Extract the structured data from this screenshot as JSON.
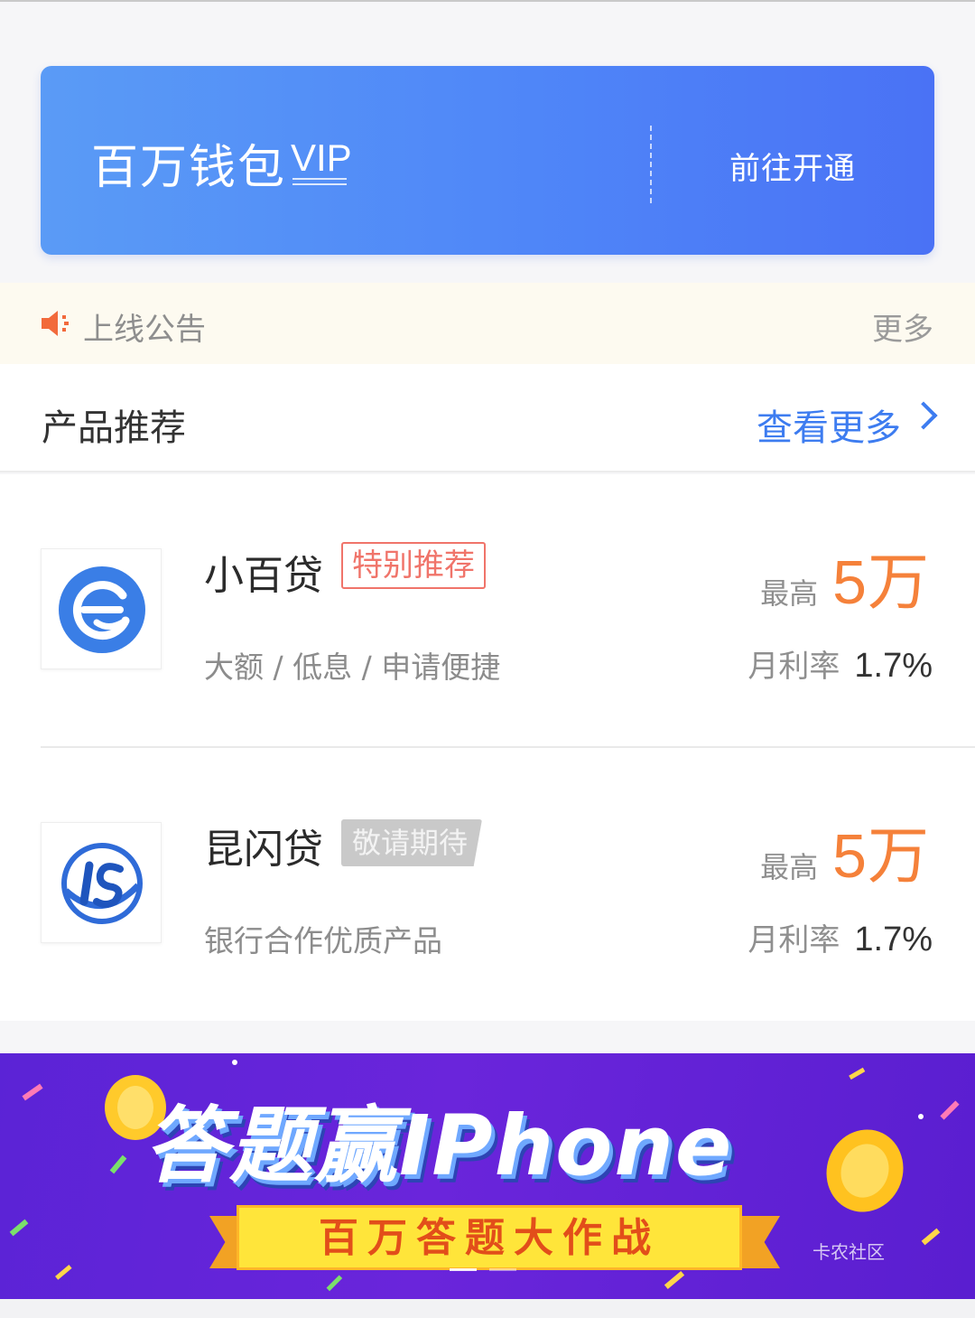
{
  "vip_banner": {
    "title": "百万钱包",
    "badge": "VIP",
    "action": "前往开通"
  },
  "notice": {
    "icon": "speaker-icon",
    "text": "上线公告",
    "more": "更多"
  },
  "section": {
    "title": "产品推荐",
    "more": "查看更多",
    "more_icon": "chevron-right-icon"
  },
  "products": [
    {
      "name": "小百贷",
      "tag": "特别推荐",
      "tag_style": "red-outline",
      "desc": "大额 / 低息 / 申请便捷",
      "amount_label": "最高",
      "amount": "5万",
      "rate_label": "月利率",
      "rate": "1.7%",
      "logo": "xiaobai-logo-icon"
    },
    {
      "name": "昆闪贷",
      "tag": "敬请期待",
      "tag_style": "grey-fill",
      "desc": "银行合作优质产品",
      "amount_label": "最高",
      "amount": "5万",
      "rate_label": "月利率",
      "rate": "1.7%",
      "logo": "kunshan-logo-icon"
    }
  ],
  "promo": {
    "title": "答题赢IPhone",
    "subtitle": "百万答题大作战",
    "watermark": "卡农社区"
  },
  "colors": {
    "vip_blue": "#4f86f8",
    "accent_orange": "#f5813a",
    "link_blue": "#3d7cf0",
    "tag_red": "#f0746a",
    "promo_purple": "#6a25db"
  }
}
